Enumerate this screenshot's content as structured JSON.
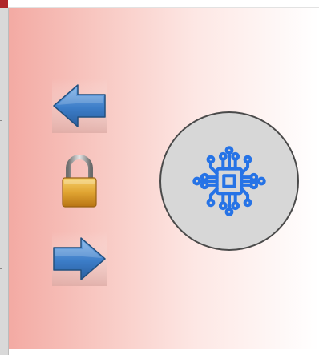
{
  "window": {
    "accent_color": "#b0262a"
  },
  "panel": {
    "gradient_start": "#f3aaa3",
    "gradient_end": "#ffffff"
  },
  "navigation": {
    "back_icon": "left-arrow-icon",
    "lock_icon": "padlock-icon",
    "forward_icon": "right-arrow-icon",
    "arrow_color": "#3c7dc8"
  },
  "processor_button": {
    "icon": "circuit-chip-icon",
    "icon_color": "#2673e6",
    "background": "#d7d7d7"
  }
}
